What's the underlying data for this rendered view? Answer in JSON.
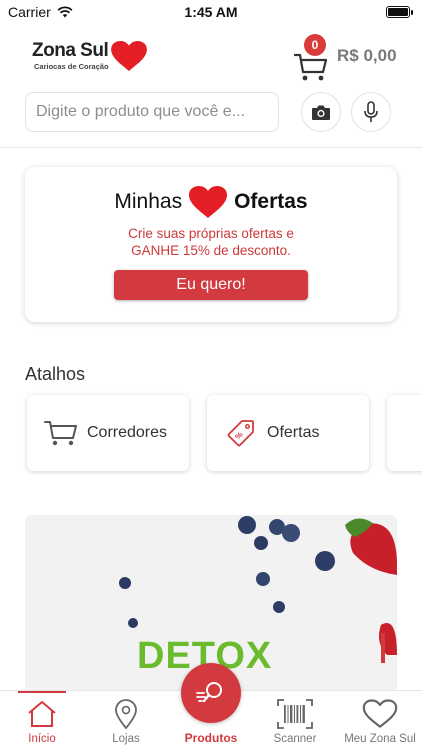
{
  "status_bar": {
    "carrier": "Carrier",
    "time": "1:45 AM"
  },
  "header": {
    "logo_text": "Zona Sul",
    "logo_tagline": "Cariocas de Coração",
    "cart_count": "0",
    "cart_total": "R$ 0,00"
  },
  "search": {
    "placeholder": "Digite o produto que você e..."
  },
  "offers": {
    "title_part1": "Minhas",
    "title_part2": "Ofertas",
    "description_line1": "Crie suas próprias ofertas e",
    "description_line2": "GANHE 15% de desconto.",
    "button_label": "Eu quero!"
  },
  "shortcuts": {
    "title": "Atalhos",
    "items": [
      {
        "label": "Corredores",
        "icon": "cart-icon"
      },
      {
        "label": "Ofertas",
        "icon": "tag-icon"
      }
    ]
  },
  "banner": {
    "text": "DETOX"
  },
  "tabbar": {
    "items": [
      {
        "label": "Início",
        "icon": "home-icon",
        "active": true
      },
      {
        "label": "Lojas",
        "icon": "location-pin-icon"
      },
      {
        "label": "Produtos",
        "icon": "product-search-icon"
      },
      {
        "label": "Scanner",
        "icon": "barcode-icon"
      },
      {
        "label": "Meu Zona Sul",
        "icon": "heart-icon"
      }
    ]
  },
  "colors": {
    "brand_red": "#d33a3f",
    "heart_red": "#e31e24",
    "detox_green": "#6bbb2e"
  }
}
